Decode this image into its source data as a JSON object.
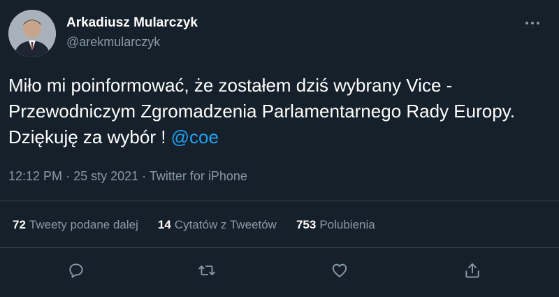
{
  "author": {
    "name": "Arkadiusz Mularczyk",
    "handle": "@arekmularczyk"
  },
  "tweet": {
    "text": "Miło mi poinformować, że zostałem dziś wybrany Vice - Przewodniczym Zgromadzenia Parlamentarnego Rady Europy. Dziękuję za wybór !",
    "mention": "@coe"
  },
  "meta": {
    "time": "12:12 PM",
    "date": "25 sty 2021",
    "source": "Twitter for iPhone"
  },
  "stats": {
    "retweets_count": "72",
    "retweets_label": "Tweety podane dalej",
    "quotes_count": "14",
    "quotes_label": "Cytatów z Tweetów",
    "likes_count": "753",
    "likes_label": "Polubienia"
  },
  "icons": {
    "more": "more-horizontal-icon",
    "reply": "reply-icon",
    "retweet": "retweet-icon",
    "like": "heart-icon",
    "share": "share-icon"
  },
  "colors": {
    "background": "#15202b",
    "text": "#ffffff",
    "secondary": "#8899a6",
    "accent": "#1da1f2",
    "divider": "#38444d"
  }
}
